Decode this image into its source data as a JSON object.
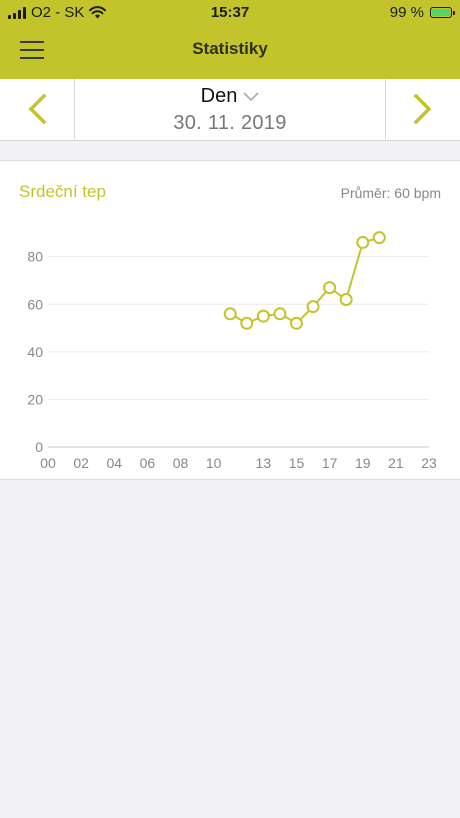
{
  "status": {
    "carrier": "O2 - SK",
    "time": "15:37",
    "battery": "99 %"
  },
  "header": {
    "title": "Statistiky"
  },
  "nav": {
    "mode": "Den",
    "date": "30. 11. 2019"
  },
  "card": {
    "title": "Srdeční tep",
    "avg_label": "Průměr:",
    "avg_value": "60 bpm"
  },
  "colors": {
    "accent": "#c3c42c",
    "grid": "#ececec",
    "axis_text": "#888888"
  },
  "chart_data": {
    "type": "line",
    "x_ticks": [
      "00",
      "02",
      "04",
      "06",
      "08",
      "10",
      "13",
      "15",
      "17",
      "19",
      "21",
      "23"
    ],
    "y_ticks": [
      0,
      20,
      40,
      60,
      80
    ],
    "ylim": [
      0,
      95
    ],
    "xlim": [
      0,
      23
    ],
    "series": [
      {
        "x": [
          11,
          12,
          13,
          14,
          15,
          16,
          17,
          18,
          19,
          20
        ],
        "y": [
          56,
          52,
          55,
          56,
          52,
          59,
          67,
          62,
          86,
          88
        ]
      }
    ],
    "grid": true
  }
}
